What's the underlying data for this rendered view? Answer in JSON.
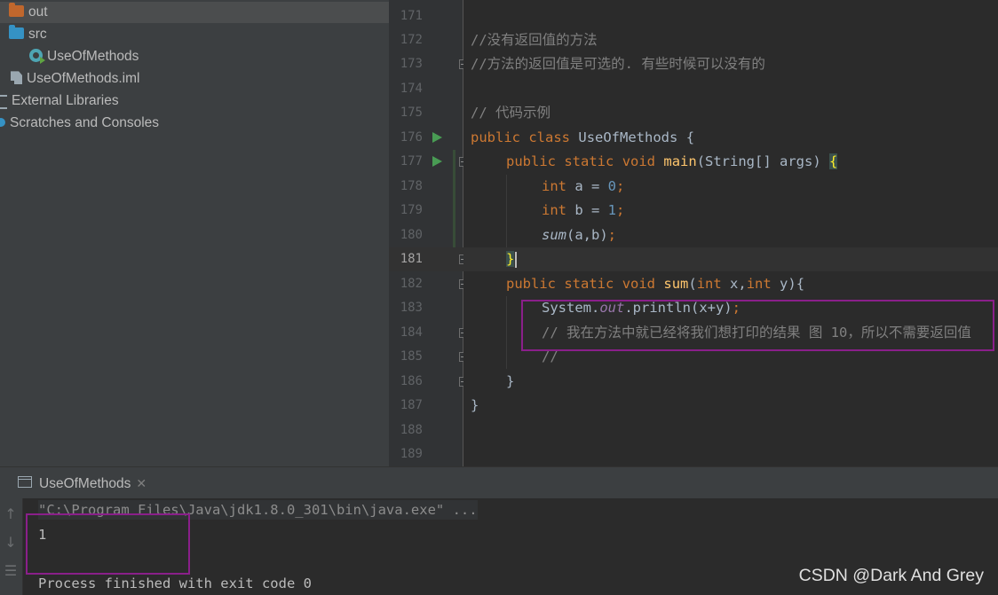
{
  "project_tree": {
    "items": [
      {
        "label": "out",
        "icon": "folder-icon"
      },
      {
        "label": "src",
        "icon": "folder-icon"
      },
      {
        "label": "UseOfMethods",
        "icon": "java-class-icon"
      },
      {
        "label": "UseOfMethods.iml",
        "icon": "module-file-icon"
      },
      {
        "label": "External Libraries",
        "icon": "library-icon"
      },
      {
        "label": "Scratches and Consoles",
        "icon": "scratch-icon"
      }
    ]
  },
  "editor": {
    "line_numbers": [
      "171",
      "172",
      "173",
      "174",
      "175",
      "176",
      "177",
      "178",
      "179",
      "180",
      "181",
      "182",
      "183",
      "184",
      "185",
      "186",
      "187",
      "188",
      "189"
    ],
    "current_line": "181",
    "code": {
      "l172": "//没有返回值的方法",
      "l173": "//方法的返回值是可选的. 有些时候可以没有的",
      "l175": "// 代码示例",
      "kw_public": "public",
      "kw_class": "class",
      "kw_static": "static",
      "kw_void": "void",
      "kw_int": "int",
      "class_name": "UseOfMethods",
      "main_name": "main",
      "main_params": "(String[] args) ",
      "var_a": " a = ",
      "var_b": " b = ",
      "val_0": "0",
      "val_1": "1",
      "semi": ";",
      "call_sum": "sum",
      "call_args": "(a,b)",
      "sum_name": "sum",
      "sum_x": " x,",
      "sum_y": " y){",
      "sys": "System.",
      "out": "out",
      "println": ".println(x+y)",
      "l184": "// 我在方法中就已经将我们想打印的结果 图 10，所以不需要返回值",
      "l185": "//",
      "brace_open": "{",
      "brace_close": "}"
    }
  },
  "run_panel": {
    "tab_label": "UseOfMethods",
    "console_lines": [
      "\"C:\\Program Files\\Java\\jdk1.8.0_301\\bin\\java.exe\" ...",
      "1",
      "Process finished with exit code 0"
    ]
  },
  "watermark": "CSDN @Dark And Grey",
  "colors": {
    "keyword": "#cc7832",
    "number": "#6897bb",
    "comment": "#808080",
    "method_decl": "#ffc66d",
    "field": "#9876aa",
    "annotation_box": "#8a1f8a"
  }
}
